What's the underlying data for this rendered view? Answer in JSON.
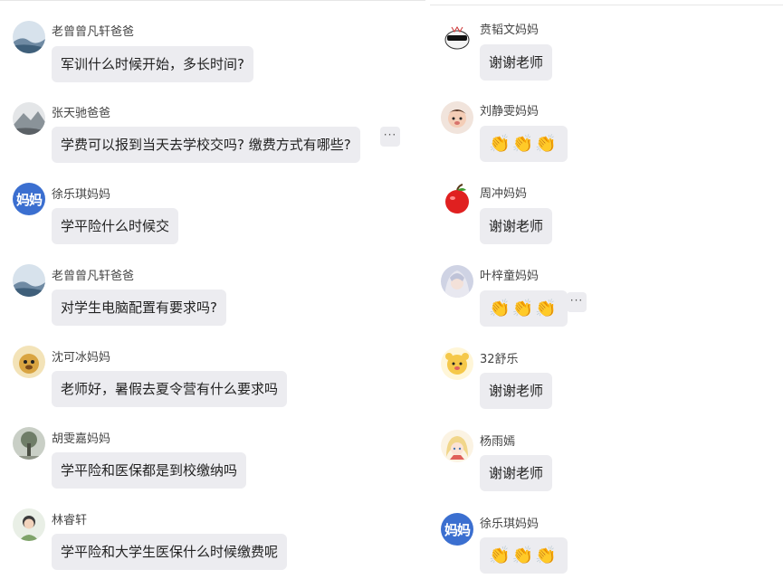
{
  "left": {
    "messages": [
      {
        "name": "老曾曾凡轩爸爸",
        "text": "军训什么时候开始，多长时间?",
        "avatar": "landscape"
      },
      {
        "name": "张天驰爸爸",
        "text": "学费可以报到当天去学校交吗? 缴费方式有哪些?",
        "avatar": "mountain"
      },
      {
        "name": "徐乐琪妈妈",
        "text": "学平险什么时候交",
        "avatar_text": "妈妈"
      },
      {
        "name": "老曾曾凡轩爸爸",
        "text": "对学生电脑配置有要求吗?",
        "avatar": "landscape"
      },
      {
        "name": "沈可冰妈妈",
        "text": "老师好，暑假去夏令营有什么要求吗",
        "avatar": "dog"
      },
      {
        "name": "胡雯嘉妈妈",
        "text": "学平险和医保都是到校缴纳吗",
        "avatar": "tree"
      },
      {
        "name": "林睿轩",
        "text": "学平险和大学生医保什么时候缴费呢",
        "avatar": "child"
      }
    ]
  },
  "right": {
    "messages": [
      {
        "name": "贲韬文妈妈",
        "text": "谢谢老师",
        "avatar": "cartoon-sunglasses"
      },
      {
        "name": "刘静雯妈妈",
        "text": "👏👏👏",
        "avatar": "baby"
      },
      {
        "name": "周冲妈妈",
        "text": "谢谢老师",
        "avatar": "apple"
      },
      {
        "name": "叶梓童妈妈",
        "text": "👏👏👏",
        "avatar": "anime"
      },
      {
        "name": "32舒乐",
        "text": "谢谢老师",
        "avatar": "bear"
      },
      {
        "name": "杨雨嫣",
        "text": "谢谢老师",
        "avatar": "anime-girl"
      },
      {
        "name": "徐乐琪妈妈",
        "text": "👏👏👏",
        "avatar_text": "妈妈"
      }
    ]
  },
  "more_label": "···",
  "colors": {
    "bubble": "#ececf0",
    "text_avatar": "#3b6fd0"
  }
}
